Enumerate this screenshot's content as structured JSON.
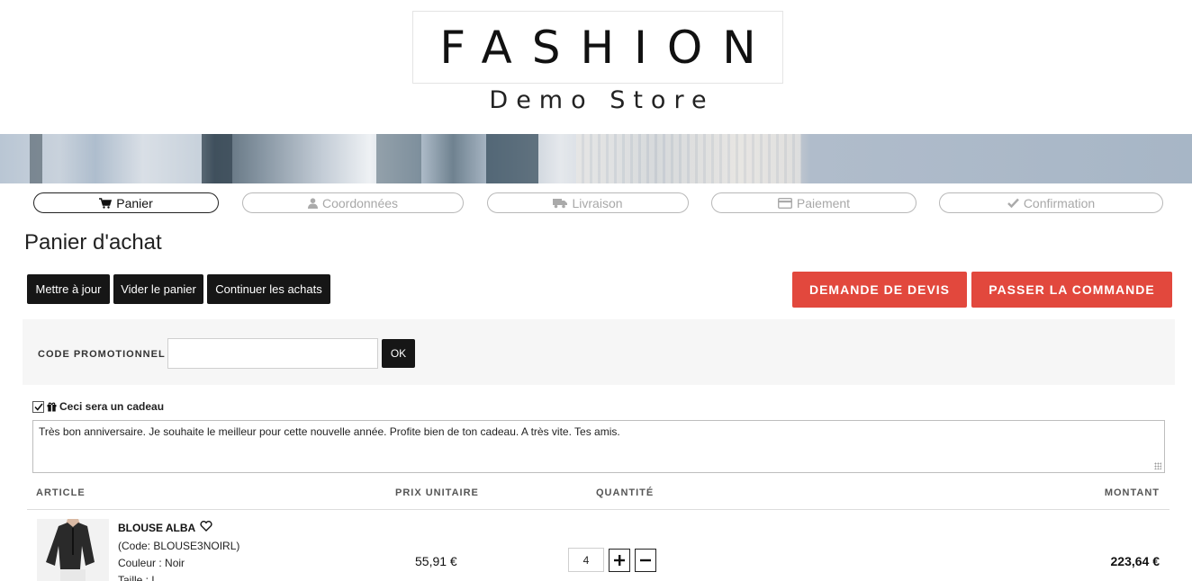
{
  "header": {
    "logo_title": "FASHION",
    "logo_subtitle": "Demo Store"
  },
  "steps": [
    {
      "label": "Panier",
      "icon": "cart-icon",
      "active": true
    },
    {
      "label": "Coordonnées",
      "icon": "user-icon",
      "active": false
    },
    {
      "label": "Livraison",
      "icon": "truck-icon",
      "active": false
    },
    {
      "label": "Paiement",
      "icon": "credit-card-icon",
      "active": false
    },
    {
      "label": "Confirmation",
      "icon": "check-icon",
      "active": false
    }
  ],
  "page_title": "Panier d'achat",
  "actions": {
    "update": "Mettre à jour",
    "empty": "Vider le panier",
    "continue": "Continuer les achats",
    "quote": "DEMANDE DE DEVIS",
    "checkout": "PASSER LA COMMANDE"
  },
  "promo": {
    "label": "CODE PROMOTIONNEL :",
    "value": "",
    "ok": "OK"
  },
  "gift": {
    "checked": true,
    "label": "Ceci sera un cadeau",
    "message": "Très bon anniversaire. Je souhaite le meilleur pour cette nouvelle année. Profite bien de ton cadeau. A très vite. Tes amis."
  },
  "table": {
    "headers": {
      "article": "ARTICLE",
      "unit_price": "PRIX UNITAIRE",
      "quantity": "QUANTITÉ",
      "amount": "MONTANT"
    },
    "rows": [
      {
        "name": "BLOUSE ALBA",
        "code": "(Code: BLOUSE3NOIRL)",
        "color": "Couleur : Noir",
        "size": "Taille : L",
        "unit_price": "55,91 €",
        "quantity": "4",
        "amount": "223,64 €"
      }
    ]
  },
  "colors": {
    "accent_red": "#e2483d",
    "dark_button": "#161616"
  }
}
